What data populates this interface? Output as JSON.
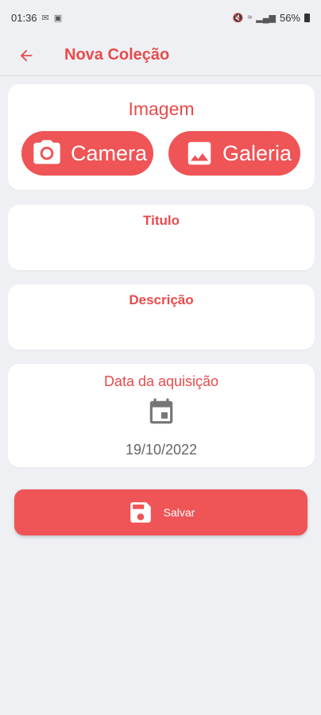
{
  "status_bar": {
    "time": "01:36",
    "left_icons": [
      "mail-icon",
      "sim-icon"
    ],
    "battery": "56%",
    "right_icons": [
      "mute-icon",
      "wifi-icon",
      "signal-icon",
      "battery-icon"
    ]
  },
  "app_bar": {
    "back_icon": "arrow-left-icon",
    "title": "Nova Coleção"
  },
  "image_section": {
    "heading": "Imagem",
    "camera_label": "Camera",
    "camera_icon": "camera-icon",
    "gallery_label": "Galeria",
    "gallery_icon": "image-icon"
  },
  "fields": {
    "title_label": "Titulo",
    "title_value": "",
    "description_label": "Descrição",
    "description_value": ""
  },
  "date_section": {
    "label": "Data da aquisição",
    "icon": "calendar-icon",
    "value": "19/10/2022"
  },
  "save_button": {
    "label": "Salvar",
    "icon": "save-icon"
  },
  "colors": {
    "accent": "#ef5456",
    "accent_text": "#e84b4b",
    "background": "#eef0f4",
    "card": "#ffffff"
  }
}
